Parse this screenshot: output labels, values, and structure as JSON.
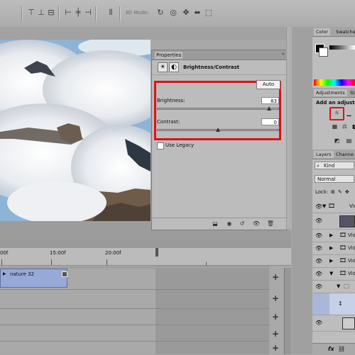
{
  "toolbar": {
    "label_3d": "3D Mode:"
  },
  "properties": {
    "tab_title": "Properties",
    "adjustment_name": "Brightness/Contrast",
    "auto_label": "Auto",
    "brightness_label": "Brightness:",
    "brightness_value": "83",
    "brightness_fraction": 0.92,
    "contrast_label": "Contrast:",
    "contrast_value": "0",
    "contrast_fraction": 0.5,
    "legacy_label": "Use Legacy"
  },
  "right_panel": {
    "tabs_top": [
      "Color",
      "Swatches"
    ],
    "tabs_adj": [
      "Adjustments",
      "St"
    ],
    "adjust_heading": "Add an adjustm",
    "tabs_layers": [
      "Layers",
      "Channe"
    ],
    "kind_label": "Kind",
    "blend_mode": "Normal",
    "lock_label": "Lock:",
    "layers": [
      "Vid",
      "Vid",
      "Vid",
      "Vid",
      "Vid"
    ]
  },
  "timeline": {
    "ruler_labels": [
      "00f",
      "15:00f",
      "20:00f"
    ],
    "clip_name": "nature 32"
  },
  "colors": {
    "highlight": "#e0101a",
    "clip": "#97a9d6"
  }
}
